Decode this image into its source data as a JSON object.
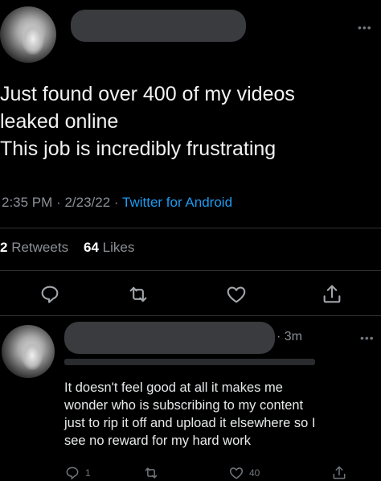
{
  "tweet": {
    "text_lines": [
      "Just found over 400 of my videos",
      "leaked online",
      "This job is incredibly frustrating"
    ],
    "time": "2:35 PM",
    "date": "2/23/22",
    "source": "Twitter for Android",
    "retweets_count": "2",
    "retweets_label": "Retweets",
    "likes_count": "64",
    "likes_label": "Likes"
  },
  "reply": {
    "time": "· 3m",
    "text_lines": [
      "It doesn't feel good at all it makes me",
      "wonder who is subscribing to my content",
      "just to rip it off and upload it elsewhere so I",
      "see no reward for my hard work"
    ],
    "reply_count": "1",
    "like_count": "40"
  },
  "icons": {
    "reply": "reply-icon",
    "retweet": "retweet-icon",
    "like": "heart-icon",
    "share": "share-icon",
    "more": "more-icon"
  },
  "colors": {
    "background": "#000000",
    "text": "#e7e9ea",
    "muted": "#8b9096",
    "link": "#1d9bf0",
    "divider": "#2f3336"
  }
}
